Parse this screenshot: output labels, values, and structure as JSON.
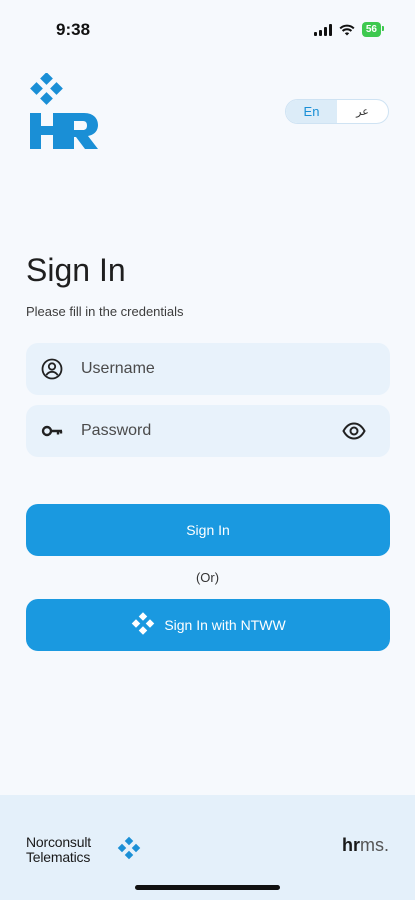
{
  "status_bar": {
    "time": "9:38",
    "battery": "56"
  },
  "language": {
    "en_label": "En",
    "ar_label": "عر",
    "selected": "En"
  },
  "login": {
    "title": "Sign In",
    "subtitle": "Please fill in the credentials",
    "username_placeholder": "Username",
    "password_placeholder": "Password",
    "sign_in_label": "Sign In",
    "or_label": "(Or)",
    "sso_label": "Sign In with NTWW"
  },
  "footer": {
    "company_line1": "Norconsult",
    "company_line2": "Telematics",
    "brand_bold": "hr",
    "brand_light": "ms."
  },
  "colors": {
    "accent": "#1a99e0",
    "field_bg": "#e8f2fb",
    "footer_bg": "#e4f0fa",
    "logo": "#1a8fd6"
  }
}
